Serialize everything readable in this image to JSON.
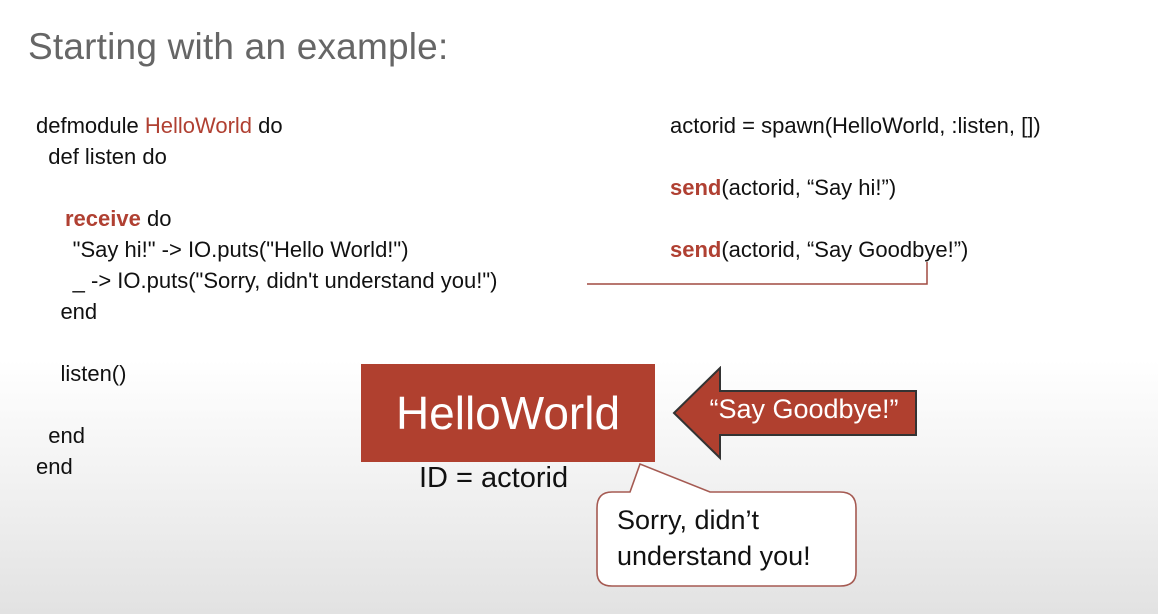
{
  "slide": {
    "title": "Starting with an example:"
  },
  "code_left": {
    "l1_a": "defmodule ",
    "l1_module": "HelloWorld",
    "l1_b": " do",
    "l2": "  def listen do",
    "l3_kw": "receive",
    "l3_b": " do",
    "l4": "      \"Say hi!\" -> IO.puts(\"Hello World!\")",
    "l5": "      _ -> IO.puts(\"Sorry, didn't understand you!\")",
    "l6": "    end",
    "l7": "    listen()",
    "l8": "  end",
    "l9": "end"
  },
  "code_right": {
    "r1": "actorid = spawn(HelloWorld, :listen, [])",
    "r2_kw": "send",
    "r2_b": "(actorid, “Say hi!”)",
    "r3_kw": "send",
    "r3_b": "(actorid, “Say Goodbye!”)"
  },
  "diagram": {
    "actor_label": "HelloWorld",
    "actor_id": "ID = actorid",
    "message": "“Say Goodbye!”",
    "reply_line1": "Sorry, didn’t",
    "reply_line2": "understand you!"
  },
  "colors": {
    "accent": "#b0402f",
    "title": "#666666",
    "connector": "#a04a40"
  }
}
